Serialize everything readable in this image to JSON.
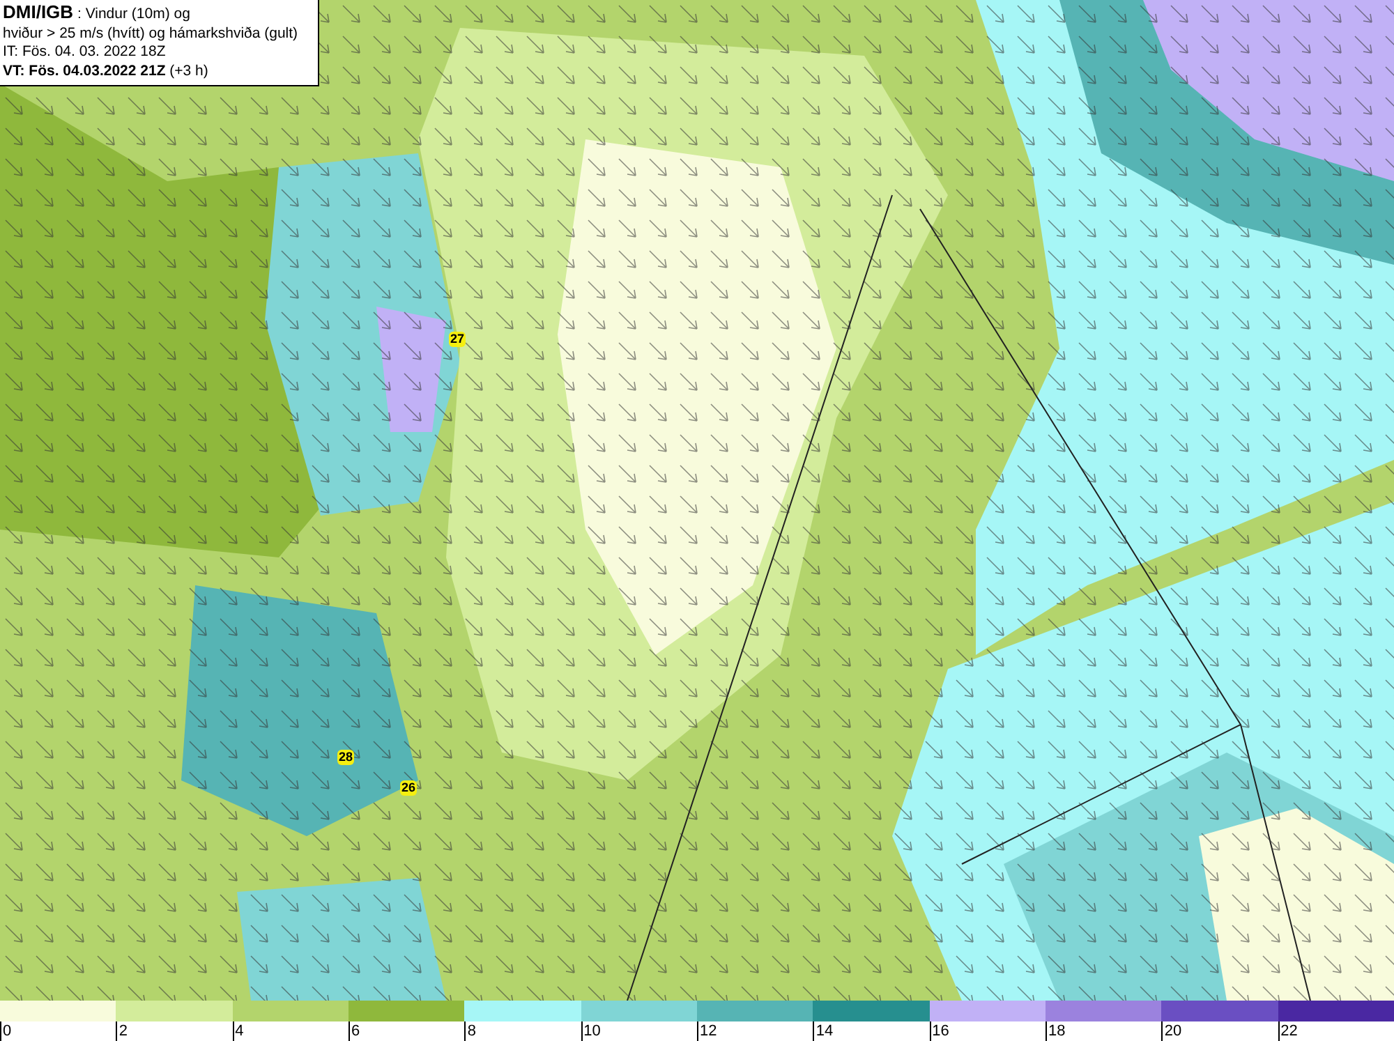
{
  "header": {
    "source": "DMI/IGB",
    "title_rest": " : Vindur (10m) og",
    "subtitle": "hviður > 25 m/s (hvítt) og hámarkshviða (gult)",
    "issue_time": "IT: Fös. 04. 03. 2022 18Z",
    "valid_time": "VT: Fös. 04.03.2022 21Z",
    "valid_offset": " (+3 h)"
  },
  "gust_labels": [
    {
      "value": "27"
    },
    {
      "value": "28"
    },
    {
      "value": "26"
    }
  ],
  "legend": [
    {
      "color": "#f8fbdc",
      "label": "0"
    },
    {
      "color": "#d3ec9b",
      "label": "2"
    },
    {
      "color": "#b3d46c",
      "label": "4"
    },
    {
      "color": "#8fb83c",
      "label": "6"
    },
    {
      "color": "#a6f6f6",
      "label": "8"
    },
    {
      "color": "#80d5d5",
      "label": "10"
    },
    {
      "color": "#56b4b4",
      "label": "12"
    },
    {
      "color": "#268f8f",
      "label": "14"
    },
    {
      "color": "#c1b1f6",
      "label": "16"
    },
    {
      "color": "#9b82de",
      "label": "18"
    },
    {
      "color": "#6a4fc2",
      "label": "20"
    },
    {
      "color": "#4a28a2",
      "label": "22"
    }
  ]
}
